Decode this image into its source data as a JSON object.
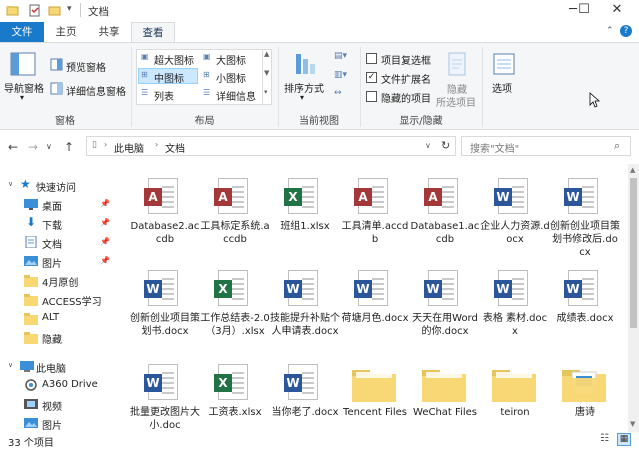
{
  "window": {
    "title": "文档",
    "controls": [
      "minimize-icon",
      "maximize-icon",
      "close-icon"
    ]
  },
  "ribbon_tabs": [
    {
      "label": "文件"
    },
    {
      "label": "主页"
    },
    {
      "label": "共享"
    },
    {
      "label": "查看"
    }
  ],
  "ribbon": {
    "pane": {
      "nav_pane": "导航窗格",
      "preview_pane": "预览窗格",
      "details_pane": "详细信息窗格",
      "group": "窗格"
    },
    "layout": {
      "items": [
        "超大图标",
        "大图标",
        "中图标",
        "小图标",
        "列表",
        "详细信息"
      ],
      "selected": "中图标",
      "group": "布局"
    },
    "current_view": {
      "sort": "排序方式",
      "group": "当前视图"
    },
    "show_hide": {
      "item_checkboxes": "项目复选框",
      "file_extensions": "文件扩展名",
      "hidden_items": "隐藏的项目",
      "hide_selected_line1": "隐藏",
      "hide_selected_line2": "所选项目",
      "group": "显示/隐藏",
      "checked": [
        false,
        true,
        false
      ]
    },
    "options": {
      "label": "选项"
    }
  },
  "address": {
    "path": [
      "此电脑",
      "文档"
    ],
    "search_placeholder": "搜索\"文档\""
  },
  "sidebar": {
    "items": [
      {
        "label": "快速访问",
        "icon": "star-icon",
        "pinned": false
      },
      {
        "label": "桌面",
        "icon": "desktop-icon",
        "pinned": true
      },
      {
        "label": "下载",
        "icon": "download-icon",
        "pinned": true
      },
      {
        "label": "文档",
        "icon": "documents-icon",
        "pinned": true
      },
      {
        "label": "图片",
        "icon": "pictures-icon",
        "pinned": true
      },
      {
        "label": "4月原创",
        "icon": "folder-icon",
        "pinned": false
      },
      {
        "label": "ACCESS学习",
        "icon": "folder-icon",
        "pinned": false
      },
      {
        "label": "ALT",
        "icon": "folder-icon",
        "pinned": false
      },
      {
        "label": "隐藏",
        "icon": "folder-icon",
        "pinned": false
      },
      {
        "label": "此电脑",
        "icon": "computer-icon",
        "pinned": false
      },
      {
        "label": "A360 Drive",
        "icon": "a360-icon",
        "pinned": false
      },
      {
        "label": "视频",
        "icon": "videos-icon",
        "pinned": false
      },
      {
        "label": "图片",
        "icon": "pictures-icon",
        "pinned": false
      }
    ]
  },
  "files": [
    {
      "name": "Database2.accdb",
      "type": "access"
    },
    {
      "name": "工具标定系统.accdb",
      "type": "access"
    },
    {
      "name": "班组1.xlsx",
      "type": "excel-sheet"
    },
    {
      "name": "工具清单.accdb",
      "type": "access"
    },
    {
      "name": "Database1.accdb",
      "type": "access"
    },
    {
      "name": "企业人力资源.docx",
      "type": "word"
    },
    {
      "name": "创新创业项目策划书修改后.docx",
      "type": "word"
    },
    {
      "name": "创新创业项目策划书.docx",
      "type": "word"
    },
    {
      "name": "工作总结表-2.0 （3月）.xlsx",
      "type": "excel"
    },
    {
      "name": "技能提升补贴个人申请表.docx",
      "type": "word"
    },
    {
      "name": "荷塘月色.docx",
      "type": "word"
    },
    {
      "name": "天天在用Word的你.docx",
      "type": "word"
    },
    {
      "name": "表格 素材.docx",
      "type": "word"
    },
    {
      "name": "成绩表.docx",
      "type": "word"
    },
    {
      "name": "批量更改图片大小.doc",
      "type": "word-old"
    },
    {
      "name": "工资表.xlsx",
      "type": "excel"
    },
    {
      "name": "当你老了.docx",
      "type": "word"
    },
    {
      "name": "Tencent Files",
      "type": "folder"
    },
    {
      "name": "WeChat Files",
      "type": "folder"
    },
    {
      "name": "teiron",
      "type": "folder"
    },
    {
      "name": "唐诗",
      "type": "folder-doc"
    }
  ],
  "status": {
    "count": "33 个项目"
  },
  "colors": {
    "accent": "#1979ca",
    "access": "#a4373a",
    "excel": "#217346",
    "word": "#2b579a",
    "folder": "#f8d775"
  }
}
